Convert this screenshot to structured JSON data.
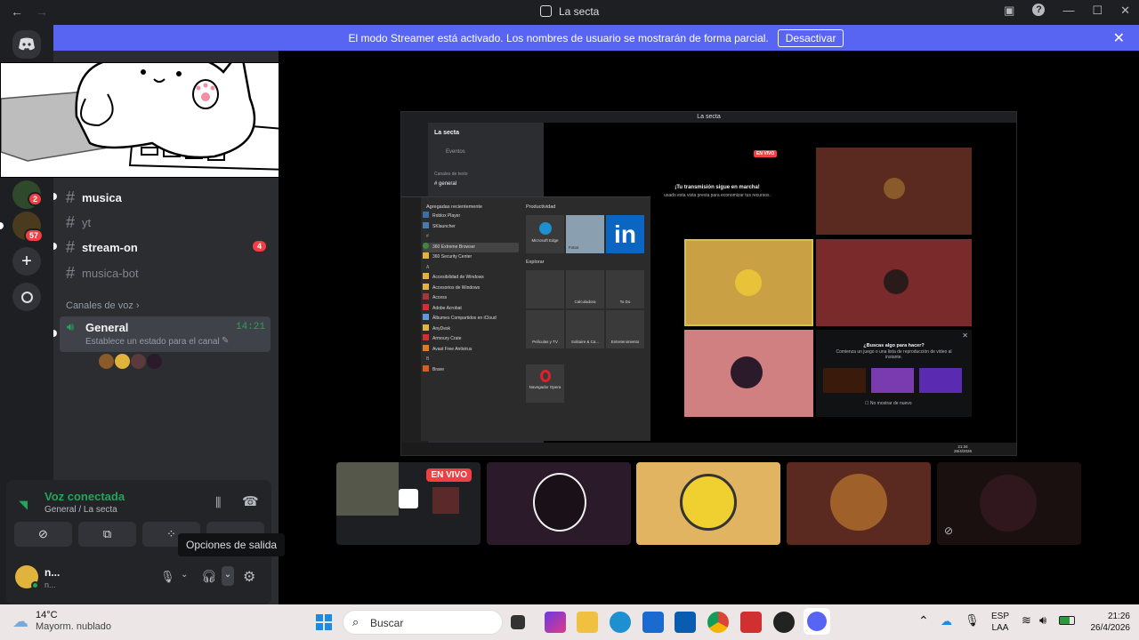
{
  "window": {
    "title": "La secta"
  },
  "banner": {
    "text": "El modo Streamer está activado. Los nombres de usuario se mostrarán de forma parcial.",
    "button": "Desactivar"
  },
  "servers": {
    "badges": [
      "2",
      "57"
    ]
  },
  "server_name": "La",
  "channels": [
    {
      "name": "musica",
      "state": "unread"
    },
    {
      "name": "yt",
      "state": "read"
    },
    {
      "name": "stream-on",
      "state": "unread",
      "badge": "4"
    },
    {
      "name": "musica-bot",
      "state": "read"
    }
  ],
  "voice_section": {
    "label": "Canales de voz"
  },
  "voice_channel": {
    "name": "General",
    "time": "14:21",
    "status": "Establece un estado para el canal"
  },
  "voice_panel": {
    "status": "Voz conectada",
    "location": "General / La secta"
  },
  "user": {
    "name": "n...",
    "sub": "n..."
  },
  "tooltip": "Opciones de salida",
  "stage": {
    "live_badge": "EN VIVO"
  },
  "stream": {
    "title": "La secta",
    "server": "La secta",
    "events": "Eventos",
    "text_cat": "Canales de texto",
    "channel": "general",
    "live": "EN VIVO",
    "msg1": "¡Tu transmisión sigue en marcha!",
    "msg2": "usado esta vista previa para economizar tus recursos.",
    "start": {
      "recent": "Agregadas recientemente",
      "apps": [
        "Roblox Player",
        "SKlauncher",
        "360 Extreme Browser",
        "360 Security Center",
        "Accesibilidad de Windows",
        "Accesorios de Windows",
        "Access",
        "Adobe Acrobat",
        "Álbumes Compartidos en iCloud",
        "AnyDesk",
        "Armoury Crate",
        "Avast Free Antivirus",
        "Brave"
      ],
      "letters": [
        "#",
        "A",
        "B"
      ],
      "prod": "Productividad",
      "explore": "Explorar",
      "tiles": [
        "Microsoft Edge",
        "Fotos",
        "Calculadora",
        "To Do",
        "Películas y TV",
        "Solitaire & Ca...",
        "Entretenimiento",
        "Navegador Opera"
      ]
    },
    "suggest": {
      "title": "¿Buscas algo para hacer?",
      "desc": "Comienza un juego o una lista de reproducción de video al instante.",
      "check": "No mostrar de nuevo"
    },
    "tray": {
      "time": "21:34",
      "date": "26/4/2026"
    }
  },
  "taskbar": {
    "weather_temp": "14°C",
    "weather_desc": "Mayorm. nublado",
    "search": "Buscar",
    "lang1": "ESP",
    "lang2": "LAA",
    "time": "21:26",
    "date": "26/4/2026"
  },
  "colors": {
    "blurple": "#5865f2",
    "green": "#23a55a",
    "red": "#f23f43"
  }
}
